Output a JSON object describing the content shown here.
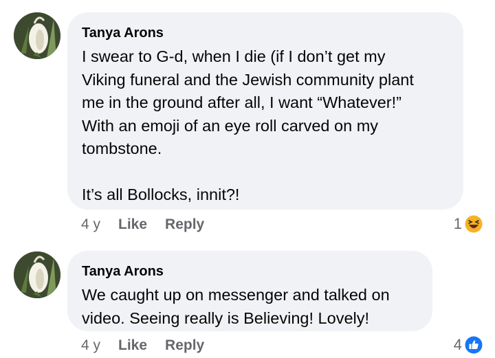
{
  "comments": [
    {
      "author": "Tanya Arons",
      "text": "I swear to G-d, when I die (if I don’t get my\nViking funeral and the Jewish community plant\nme in the ground after all, I want “Whatever!”\nWith an emoji of an eye roll carved on my\ntombstone.\n\nIt’s all Bollocks, innit?!",
      "time": "4 y",
      "like_label": "Like",
      "reply_label": "Reply",
      "reaction_count": "1",
      "reaction_icon": "laughing-emoji-icon"
    },
    {
      "author": "Tanya Arons",
      "text": "We caught up on messenger and talked on\nvideo.  Seeing really is Believing!  Lovely!",
      "time": "4 y",
      "like_label": "Like",
      "reply_label": "Reply",
      "reaction_count": "4",
      "reaction_icon": "thumbs-up-icon"
    }
  ],
  "colors": {
    "bubble": "#f0f2f5",
    "meta_text": "#65676b",
    "like_blue": "#1877f2",
    "haha_yellow": "#f7b125"
  }
}
